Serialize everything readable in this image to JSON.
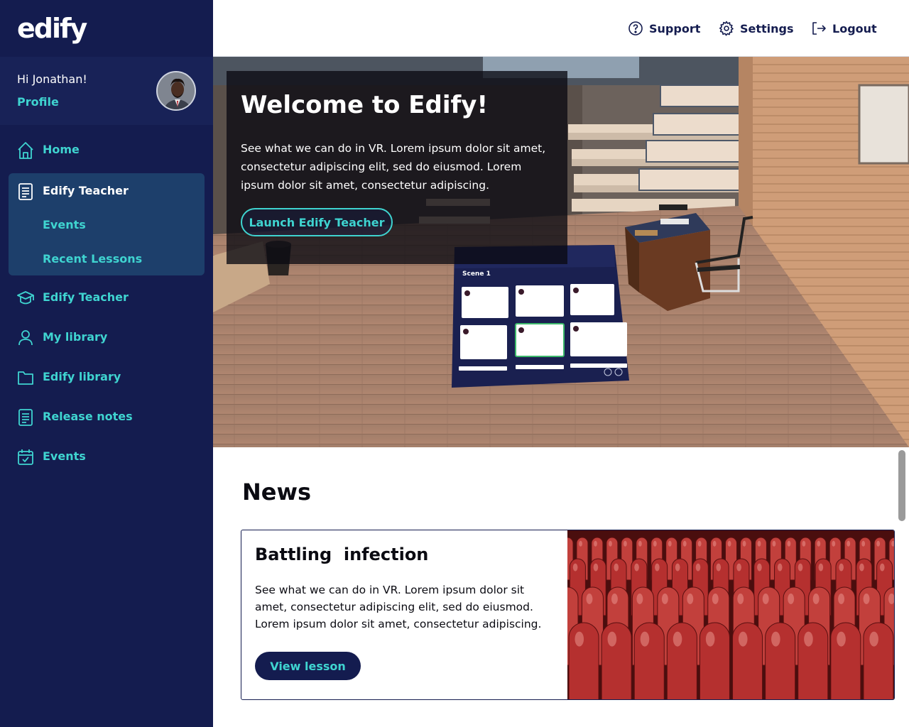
{
  "brand": {
    "logo_text": "edify"
  },
  "user": {
    "greeting": "Hi Jonathan!",
    "profile_label": "Profile"
  },
  "sidebar": {
    "items": [
      {
        "label": "Home",
        "icon": "home-icon"
      },
      {
        "label": "Edify Teacher",
        "icon": "document-icon",
        "active": true,
        "subitems": [
          {
            "label": "Events"
          },
          {
            "label": "Recent Lessons"
          }
        ]
      },
      {
        "label": "Edify Teacher",
        "icon": "graduation-cap-icon"
      },
      {
        "label": "My library",
        "icon": "user-icon"
      },
      {
        "label": "Edify library",
        "icon": "folder-icon"
      },
      {
        "label": "Release notes",
        "icon": "document-icon"
      },
      {
        "label": "Events",
        "icon": "calendar-icon"
      }
    ]
  },
  "header": {
    "support_label": "Support",
    "settings_label": "Settings",
    "logout_label": "Logout"
  },
  "hero": {
    "title": "Welcome to Edify!",
    "text": "See what we can do in VR. Lorem ipsum dolor sit amet, consectetur adipiscing elit, sed do eiusmod. Lorem ipsum dolor sit amet, consectetur adipiscing.",
    "button_label": "Launch Edify Teacher",
    "panel_title": "Scene 1"
  },
  "news": {
    "title": "News",
    "card": {
      "title": "Battling  infection",
      "text": "See what we can do in VR. Lorem ipsum dolor sit amet, consectetur adipiscing elit, sed do eiusmod. Lorem ipsum dolor sit amet, consectetur adipiscing.",
      "button_label": "View lesson"
    }
  },
  "colors": {
    "sidebar_bg": "#141c4f",
    "accent": "#3fd4d0",
    "active_bg": "#1d3f6b"
  }
}
